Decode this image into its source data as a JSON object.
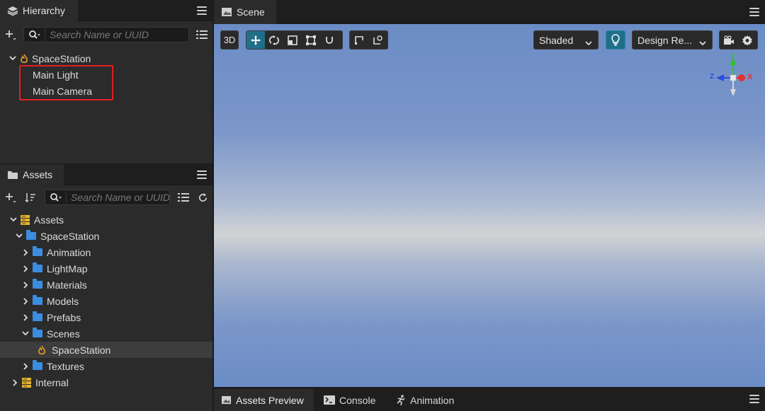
{
  "hierarchy": {
    "tab_label": "Hierarchy",
    "search_placeholder": "Search Name or UUID",
    "root": "SpaceStation",
    "children": [
      "Main Light",
      "Main Camera"
    ],
    "highlight_color": "#e02020"
  },
  "assets": {
    "tab_label": "Assets",
    "search_placeholder": "Search Name or UUID",
    "tree": {
      "root": "Assets",
      "project": "SpaceStation",
      "folders": [
        "Animation",
        "LightMap",
        "Materials",
        "Models",
        "Prefabs",
        "Scenes"
      ],
      "scene_file": "SpaceStation",
      "after_folders": [
        "Textures"
      ],
      "internal": "Internal"
    }
  },
  "scene": {
    "tab_label": "Scene",
    "btn_3d": "3D",
    "shading": "Shaded",
    "resolution": "Design Re...",
    "gizmo": {
      "x": "X",
      "y": "Y",
      "z": "Z"
    },
    "active_tool": "move",
    "accent": "#1f6f89"
  },
  "bottom_tabs": {
    "assets_preview": "Assets Preview",
    "console": "Console",
    "animation": "Animation"
  },
  "colors": {
    "folder": "#3b8de0",
    "assets_db": "#e8b730",
    "scene_flame": "#e8a030",
    "gizmo_x": "#e53030",
    "gizmo_y": "#30c030",
    "gizmo_z": "#2d4de0"
  }
}
